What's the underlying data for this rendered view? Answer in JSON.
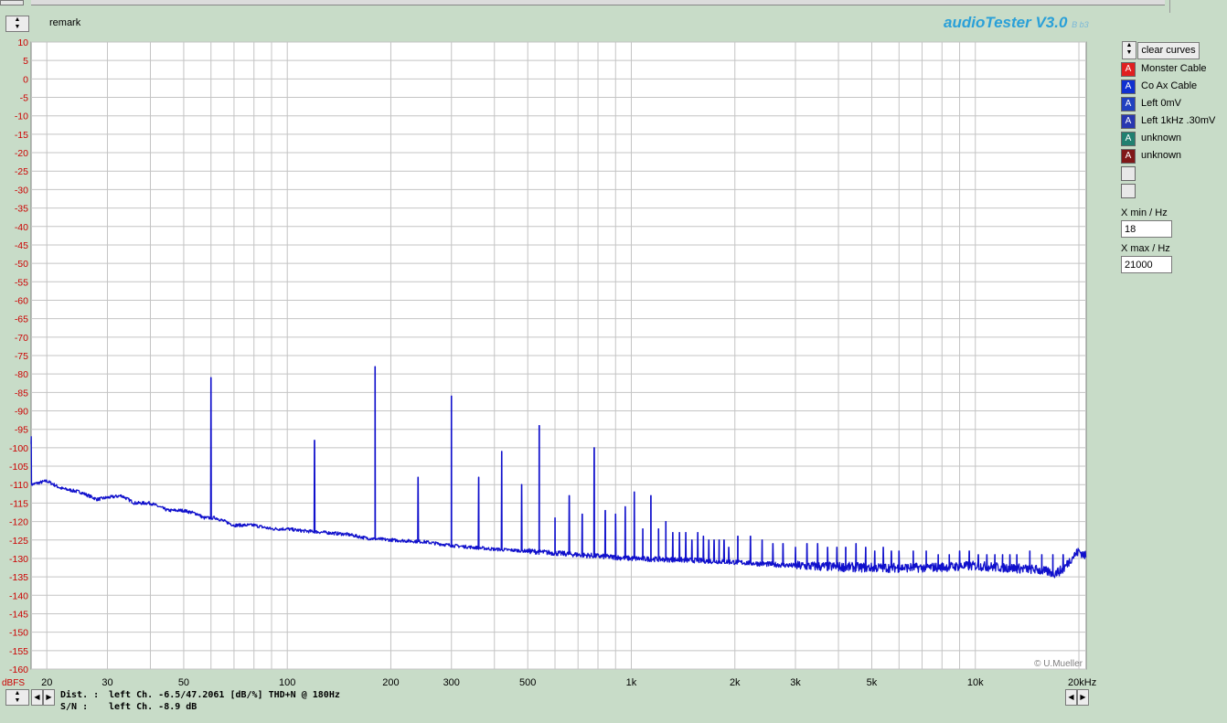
{
  "header": {
    "remark": "remark",
    "brand_title": "audioTester V3.0",
    "brand_build": "B b3"
  },
  "chart_data": {
    "type": "line",
    "x_scale": "log",
    "xlim": [
      18,
      21000
    ],
    "ylim": [
      -160,
      10
    ],
    "ylabel": "dBFS",
    "grid": true,
    "y_ticks": [
      10,
      5,
      0,
      -5,
      -10,
      -15,
      -20,
      -25,
      -30,
      -35,
      -40,
      -45,
      -50,
      -55,
      -60,
      -65,
      -70,
      -75,
      -80,
      -85,
      -90,
      -95,
      -100,
      -105,
      -110,
      -115,
      -120,
      -125,
      -130,
      -135,
      -140,
      -145,
      -150,
      -155,
      -160
    ],
    "x_ticks": [
      {
        "v": 20,
        "label": "20"
      },
      {
        "v": 30,
        "label": "30"
      },
      {
        "v": 50,
        "label": "50"
      },
      {
        "v": 100,
        "label": "100"
      },
      {
        "v": 200,
        "label": "200"
      },
      {
        "v": 300,
        "label": "300"
      },
      {
        "v": 500,
        "label": "500"
      },
      {
        "v": 1000,
        "label": "1k"
      },
      {
        "v": 2000,
        "label": "2k"
      },
      {
        "v": 3000,
        "label": "3k"
      },
      {
        "v": 5000,
        "label": "5k"
      },
      {
        "v": 10000,
        "label": "10k"
      },
      {
        "v": 20000,
        "label": "20kHz"
      }
    ],
    "copyright": "© U.Mueller",
    "series": [
      {
        "color": "#1010cc",
        "floor": [
          [
            18,
            -110
          ],
          [
            20,
            -109
          ],
          [
            22,
            -111
          ],
          [
            25,
            -112
          ],
          [
            28,
            -114
          ],
          [
            30,
            -113.5
          ],
          [
            33,
            -113
          ],
          [
            36,
            -115
          ],
          [
            40,
            -115
          ],
          [
            45,
            -117
          ],
          [
            50,
            -117
          ],
          [
            55,
            -118
          ],
          [
            57,
            -119
          ],
          [
            62,
            -119
          ],
          [
            70,
            -121
          ],
          [
            80,
            -121
          ],
          [
            90,
            -122
          ],
          [
            100,
            -122
          ],
          [
            110,
            -122.5
          ],
          [
            130,
            -123
          ],
          [
            150,
            -123.5
          ],
          [
            170,
            -124.5
          ],
          [
            200,
            -125
          ],
          [
            250,
            -125.5
          ],
          [
            300,
            -126.5
          ],
          [
            400,
            -127.5
          ],
          [
            500,
            -128
          ],
          [
            700,
            -129
          ],
          [
            1000,
            -130
          ],
          [
            1500,
            -130.5
          ],
          [
            2000,
            -131
          ],
          [
            3000,
            -132
          ],
          [
            5000,
            -132.5
          ],
          [
            7000,
            -132.5
          ],
          [
            10000,
            -132
          ],
          [
            15000,
            -133
          ],
          [
            17000,
            -134
          ],
          [
            18000,
            -133
          ],
          [
            19000,
            -130
          ],
          [
            20000,
            -128
          ],
          [
            21000,
            -129.5
          ]
        ],
        "peaks": [
          [
            18,
            -99
          ],
          [
            60,
            -83
          ],
          [
            120,
            -100
          ],
          [
            180,
            -80
          ],
          [
            240,
            -110
          ],
          [
            300,
            -88
          ],
          [
            360,
            -110
          ],
          [
            420,
            -103
          ],
          [
            480,
            -112
          ],
          [
            540,
            -96
          ],
          [
            600,
            -121
          ],
          [
            660,
            -115
          ],
          [
            720,
            -120
          ],
          [
            780,
            -102
          ],
          [
            840,
            -119
          ],
          [
            900,
            -120
          ],
          [
            960,
            -118
          ],
          [
            1020,
            -114
          ],
          [
            1080,
            -124
          ],
          [
            1140,
            -115
          ],
          [
            1200,
            -124
          ],
          [
            1260,
            -122
          ],
          [
            1320,
            -125
          ],
          [
            1380,
            -125
          ],
          [
            1440,
            -125
          ],
          [
            1500,
            -127
          ],
          [
            1560,
            -125
          ],
          [
            1620,
            -126
          ],
          [
            1680,
            -127
          ],
          [
            1740,
            -127
          ],
          [
            1800,
            -127
          ],
          [
            1860,
            -127
          ],
          [
            1920,
            -129
          ],
          [
            2040,
            -126
          ],
          [
            2220,
            -126
          ],
          [
            2400,
            -127
          ],
          [
            2580,
            -128
          ],
          [
            2760,
            -128
          ],
          [
            3000,
            -129
          ],
          [
            3240,
            -128
          ],
          [
            3480,
            -128
          ],
          [
            3720,
            -129
          ],
          [
            3960,
            -129
          ],
          [
            4200,
            -129
          ],
          [
            4500,
            -128
          ],
          [
            4800,
            -129
          ],
          [
            5100,
            -130
          ],
          [
            5400,
            -129
          ],
          [
            5700,
            -130
          ],
          [
            6000,
            -130
          ],
          [
            6600,
            -130
          ],
          [
            7200,
            -130
          ],
          [
            7800,
            -131
          ],
          [
            8400,
            -131
          ],
          [
            9000,
            -130
          ],
          [
            9600,
            -130
          ],
          [
            10200,
            -131
          ],
          [
            10800,
            -131
          ],
          [
            11400,
            -131
          ],
          [
            12000,
            -131
          ],
          [
            12600,
            -131
          ],
          [
            13200,
            -131
          ],
          [
            14400,
            -130
          ],
          [
            15600,
            -131
          ],
          [
            16800,
            -131
          ],
          [
            18000,
            -131
          ]
        ]
      }
    ]
  },
  "sidebar": {
    "clear_label": "clear curves",
    "legend": [
      {
        "label": "Monster Cable",
        "color": "#e02020"
      },
      {
        "label": "Co Ax Cable",
        "color": "#1030d0"
      },
      {
        "label": "Left 0mV",
        "color": "#2040c0"
      },
      {
        "label": "Left 1kHz .30mV",
        "color": "#2838b0"
      },
      {
        "label": "unknown",
        "color": "#208070"
      },
      {
        "label": "unknown",
        "color": "#801818"
      },
      {
        "label": "",
        "color": "#e8e8e8"
      },
      {
        "label": "",
        "color": "#e8e8e8"
      }
    ],
    "xmin_label": "X min / Hz",
    "xmin_value": "18",
    "xmax_label": "X max / Hz",
    "xmax_value": "21000",
    "legend_glyph": "A"
  },
  "stats": {
    "dist_label": "Dist. :",
    "dist_value": "left Ch. -6.5/47.2061 [dB/%] THD+N  @ 180Hz",
    "sn_label": "S/N :",
    "sn_value": "left Ch. -8.9 dB"
  }
}
